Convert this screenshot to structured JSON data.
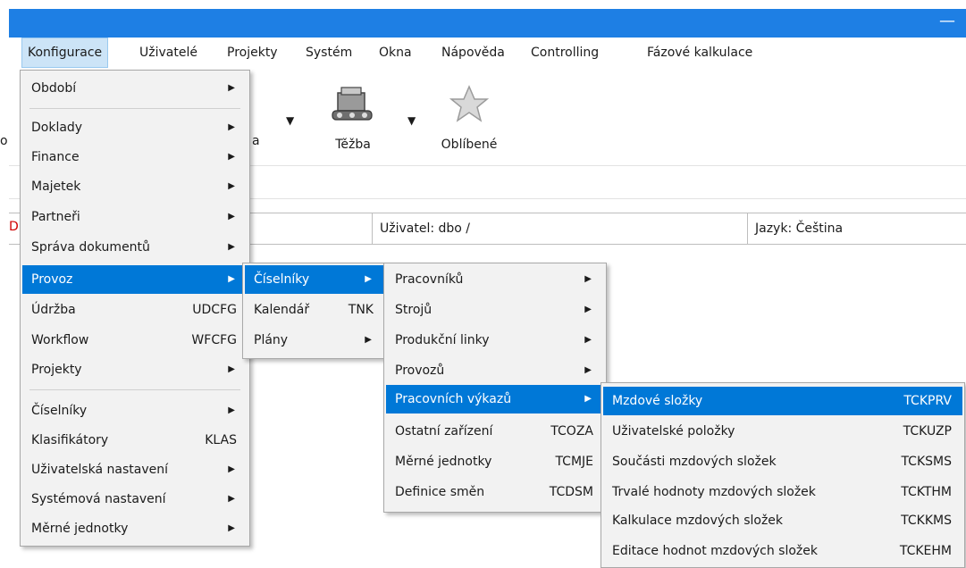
{
  "menubar": {
    "items": [
      "Konfigurace",
      "Uživatelé",
      "Projekty",
      "Systém",
      "Okna",
      "Nápověda",
      "Controlling",
      "Fázové kalkulace"
    ]
  },
  "toolbar": {
    "cut_label": "o",
    "left_partial": "a",
    "tezba": "Těžba",
    "oblibene": "Oblíbené"
  },
  "status": {
    "marker": "D",
    "user": "Uživatel: dbo /",
    "language": "Jazyk: Čeština"
  },
  "menu1": {
    "items": [
      {
        "label": "Období",
        "arrow": true
      },
      {
        "label": "Doklady",
        "arrow": true
      },
      {
        "label": "Finance",
        "arrow": true
      },
      {
        "label": "Majetek",
        "arrow": true
      },
      {
        "label": "Partneři",
        "arrow": true
      },
      {
        "label": "Správa dokumentů",
        "arrow": true
      },
      {
        "label": "Provoz",
        "arrow": true
      },
      {
        "label": "Údržba",
        "shortcut": "UDCFG"
      },
      {
        "label": "Workflow",
        "shortcut": "WFCFG"
      },
      {
        "label": "Projekty",
        "arrow": true
      },
      {
        "label": "Číselníky",
        "arrow": true
      },
      {
        "label": "Klasifikátory",
        "shortcut": "KLAS"
      },
      {
        "label": "Uživatelská nastavení",
        "arrow": true
      },
      {
        "label": "Systémová nastavení",
        "arrow": true
      },
      {
        "label": "Měrné jednotky",
        "arrow": true
      }
    ]
  },
  "menu2": {
    "items": [
      {
        "label": "Číselníky",
        "arrow": true
      },
      {
        "label": "Kalendář",
        "shortcut": "TNK"
      },
      {
        "label": "Plány",
        "arrow": true
      }
    ]
  },
  "menu3": {
    "items": [
      {
        "label": "Pracovníků",
        "arrow": true
      },
      {
        "label": "Strojů",
        "arrow": true
      },
      {
        "label": "Produkční linky",
        "arrow": true
      },
      {
        "label": "Provozů",
        "arrow": true
      },
      {
        "label": "Pracovních výkazů",
        "arrow": true
      },
      {
        "label": "Ostatní zařízení",
        "shortcut": "TCOZA"
      },
      {
        "label": "Měrné jednotky",
        "shortcut": "TCMJE"
      },
      {
        "label": "Definice směn",
        "shortcut": "TCDSM"
      }
    ]
  },
  "menu4": {
    "items": [
      {
        "label": "Mzdové složky",
        "shortcut": "TCKPRV"
      },
      {
        "label": "Uživatelské položky",
        "shortcut": "TCKUZP"
      },
      {
        "label": "Součásti mzdových složek",
        "shortcut": "TCKSMS"
      },
      {
        "label": "Trvalé hodnoty mzdových složek",
        "shortcut": "TCKTHM"
      },
      {
        "label": "Kalkulace mzdových složek",
        "shortcut": "TCKKMS"
      },
      {
        "label": "Editace hodnot mzdových složek",
        "shortcut": "TCKEHM"
      }
    ]
  },
  "colors": {
    "titlebar": "#1e7fe4",
    "highlight": "#0078d7"
  },
  "icons": {
    "star": "star-icon",
    "machine": "machine-icon",
    "arrow": "submenu-arrow-icon"
  }
}
